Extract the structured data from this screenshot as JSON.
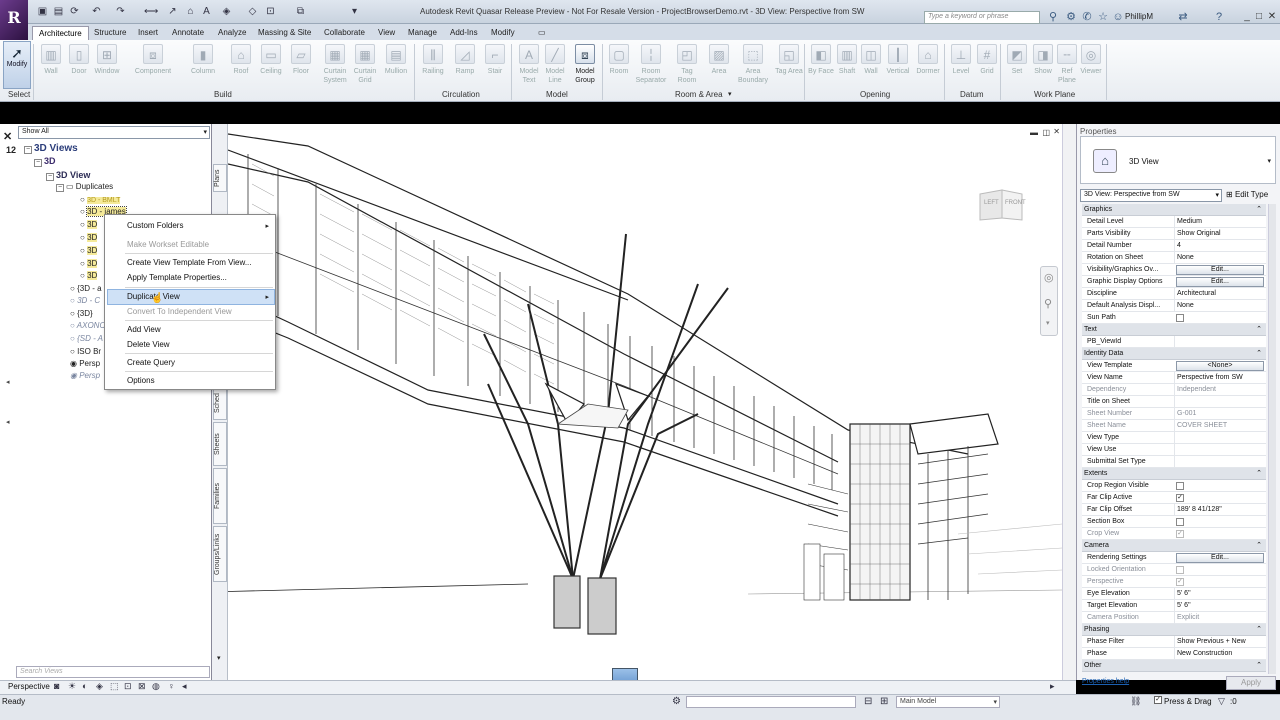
{
  "app": {
    "title": "Autodesk Revit Quasar Release Preview - Not For Resale Version -    ProjectBrowserDemo.rvt - 3D View: Perspective from SW",
    "logo_letter": "R",
    "search_placeholder": "Type a keyword or phrase",
    "user": "PhillipM"
  },
  "ribbon": {
    "tabs": [
      "Architecture",
      "Structure",
      "Insert",
      "Annotate",
      "Analyze",
      "Massing & Site",
      "Collaborate",
      "View",
      "Manage",
      "Add-Ins",
      "Modify"
    ],
    "active_tab": "Architecture",
    "modify_label": "Modify",
    "select_label": "Select",
    "build": {
      "label": "Build",
      "buttons": [
        "Wall",
        "Door",
        "Window",
        "Component",
        "Column",
        "Roof",
        "Ceiling",
        "Floor",
        "Curtain System",
        "Curtain Grid",
        "Mullion"
      ]
    },
    "circulation": {
      "label": "Circulation",
      "buttons": [
        "Railing",
        "Ramp",
        "Stair"
      ]
    },
    "model": {
      "label": "Model",
      "buttons": [
        "Model Text",
        "Model Line",
        "Model Group"
      ]
    },
    "room_area": {
      "label": "Room & Area",
      "buttons": [
        "Room",
        "Room Separator",
        "Tag Room",
        "Area",
        "Area Boundary",
        "Tag Area"
      ]
    },
    "opening": {
      "label": "Opening",
      "buttons": [
        "By Face",
        "Shaft",
        "Wall",
        "Vertical",
        "Dormer"
      ]
    },
    "datum": {
      "label": "Datum",
      "buttons": [
        "Level",
        "Grid"
      ]
    },
    "work_plane": {
      "label": "Work Plane",
      "buttons": [
        "Set",
        "Show",
        "Ref Plane",
        "Viewer"
      ]
    }
  },
  "browser": {
    "filter": "Show All",
    "number": "12",
    "search_placeholder": "Search Views",
    "tree": [
      {
        "label": "3D Views",
        "style": "bold-blue"
      },
      {
        "label": "3D",
        "style": "bold"
      },
      {
        "label": "3D View",
        "style": "bold"
      },
      {
        "label": "Duplicates",
        "style": "normal"
      },
      {
        "label": "3D - BMLT",
        "style": "hl"
      },
      {
        "label": "3D - james",
        "style": "hl"
      },
      {
        "label": "3D",
        "style": "hl"
      },
      {
        "label": "3D",
        "style": "hl"
      },
      {
        "label": "3D",
        "style": "hl"
      },
      {
        "label": "3D",
        "style": "hl"
      },
      {
        "label": "3D",
        "style": "hl"
      },
      {
        "label": "{3D - a",
        "style": "normal"
      },
      {
        "label": "3D - C",
        "style": "grey"
      },
      {
        "label": "{3D}",
        "style": "normal"
      },
      {
        "label": "AXONO",
        "style": "grey"
      },
      {
        "label": "{SD - A",
        "style": "grey"
      },
      {
        "label": "ISO Br",
        "style": "normal"
      },
      {
        "label": "Persp",
        "style": "normal"
      },
      {
        "label": "Persp",
        "style": "grey"
      }
    ],
    "side_tabs": [
      "Plans",
      "Sched",
      "Sheets",
      "Families",
      "Groups/Links"
    ]
  },
  "context_menu": {
    "items": [
      {
        "label": "Custom Folders",
        "disabled": false,
        "submenu": true
      },
      {
        "label": "Make Workset Editable",
        "disabled": true,
        "submenu": false
      },
      {
        "label": "Create View Template From View...",
        "disabled": false,
        "submenu": false
      },
      {
        "label": "Apply Template Properties...",
        "disabled": false,
        "submenu": false
      },
      {
        "label": "Duplicate View",
        "disabled": false,
        "submenu": true
      },
      {
        "label": "Convert To Independent View",
        "disabled": true,
        "submenu": false
      },
      {
        "label": "Add View",
        "disabled": false,
        "submenu": false
      },
      {
        "label": "Delete View",
        "disabled": false,
        "submenu": false
      },
      {
        "label": "Create Query",
        "disabled": false,
        "submenu": false
      },
      {
        "label": "Options",
        "disabled": false,
        "submenu": false
      }
    ],
    "highlighted": "Duplicate View"
  },
  "viewcube": {
    "left": "LEFT",
    "front": "FRONT"
  },
  "properties": {
    "title": "Properties",
    "type_name": "3D View",
    "selector": "3D View: Perspective from SW",
    "edit_type": "Edit Type",
    "groups": {
      "graphics": "Graphics",
      "text": "Text",
      "identity": "Identity Data",
      "extents": "Extents",
      "camera": "Camera",
      "phasing": "Phasing",
      "other": "Other"
    },
    "rows": {
      "detail_level": [
        "Detail Level",
        "Medium"
      ],
      "parts_visibility": [
        "Parts Visibility",
        "Show Original"
      ],
      "detail_number": [
        "Detail Number",
        "4"
      ],
      "rotation": [
        "Rotation on Sheet",
        "None"
      ],
      "vg_overrides": [
        "Visibility/Graphics Ov...",
        "Edit..."
      ],
      "gdo": [
        "Graphic Display Options",
        "Edit..."
      ],
      "discipline": [
        "Discipline",
        "Architectural"
      ],
      "analysis_display": [
        "Default Analysis Displ...",
        "None"
      ],
      "sun_path": [
        "Sun Path",
        ""
      ],
      "pb_viewid": [
        "PB_ViewId",
        ""
      ],
      "view_template": [
        "View Template",
        "<None>"
      ],
      "view_name": [
        "View Name",
        "Perspective from SW"
      ],
      "dependency": [
        "Dependency",
        "Independent"
      ],
      "title_on_sheet": [
        "Title on Sheet",
        ""
      ],
      "sheet_number": [
        "Sheet Number",
        "G-001"
      ],
      "sheet_name": [
        "Sheet Name",
        "COVER SHEET"
      ],
      "view_type": [
        "View Type",
        ""
      ],
      "view_use": [
        "View Use",
        ""
      ],
      "submittal_set_type": [
        "Submittal Set Type",
        ""
      ],
      "crop_region_visible": [
        "Crop Region Visible",
        ""
      ],
      "far_clip_active": [
        "Far Clip Active",
        "✓"
      ],
      "far_clip_offset": [
        "Far Clip Offset",
        "189'  8 41/128\""
      ],
      "section_box": [
        "Section Box",
        ""
      ],
      "crop_view": [
        "Crop View",
        "✓"
      ],
      "rendering_settings": [
        "Rendering Settings",
        "Edit..."
      ],
      "locked_orientation": [
        "Locked Orientation",
        ""
      ],
      "perspective": [
        "Perspective",
        "✓"
      ],
      "eye_elevation": [
        "Eye Elevation",
        "5'  6\""
      ],
      "target_elevation": [
        "Target Elevation",
        "5'  6\""
      ],
      "camera_position": [
        "Camera Position",
        "Explicit"
      ],
      "phase_filter": [
        "Phase Filter",
        "Show Previous + New"
      ],
      "phase": [
        "Phase",
        "New Construction"
      ]
    },
    "help_link": "Properties help",
    "apply": "Apply"
  },
  "view_control": {
    "mode": "Perspective"
  },
  "status": {
    "ready": "Ready",
    "model": "Main Model",
    "press_drag": "Press & Drag",
    "filter_count": ":0"
  },
  "colors": {
    "accent": "#3a5a80",
    "highlight": "#f5ea9a",
    "menu_hover": "#cfe1f6"
  }
}
